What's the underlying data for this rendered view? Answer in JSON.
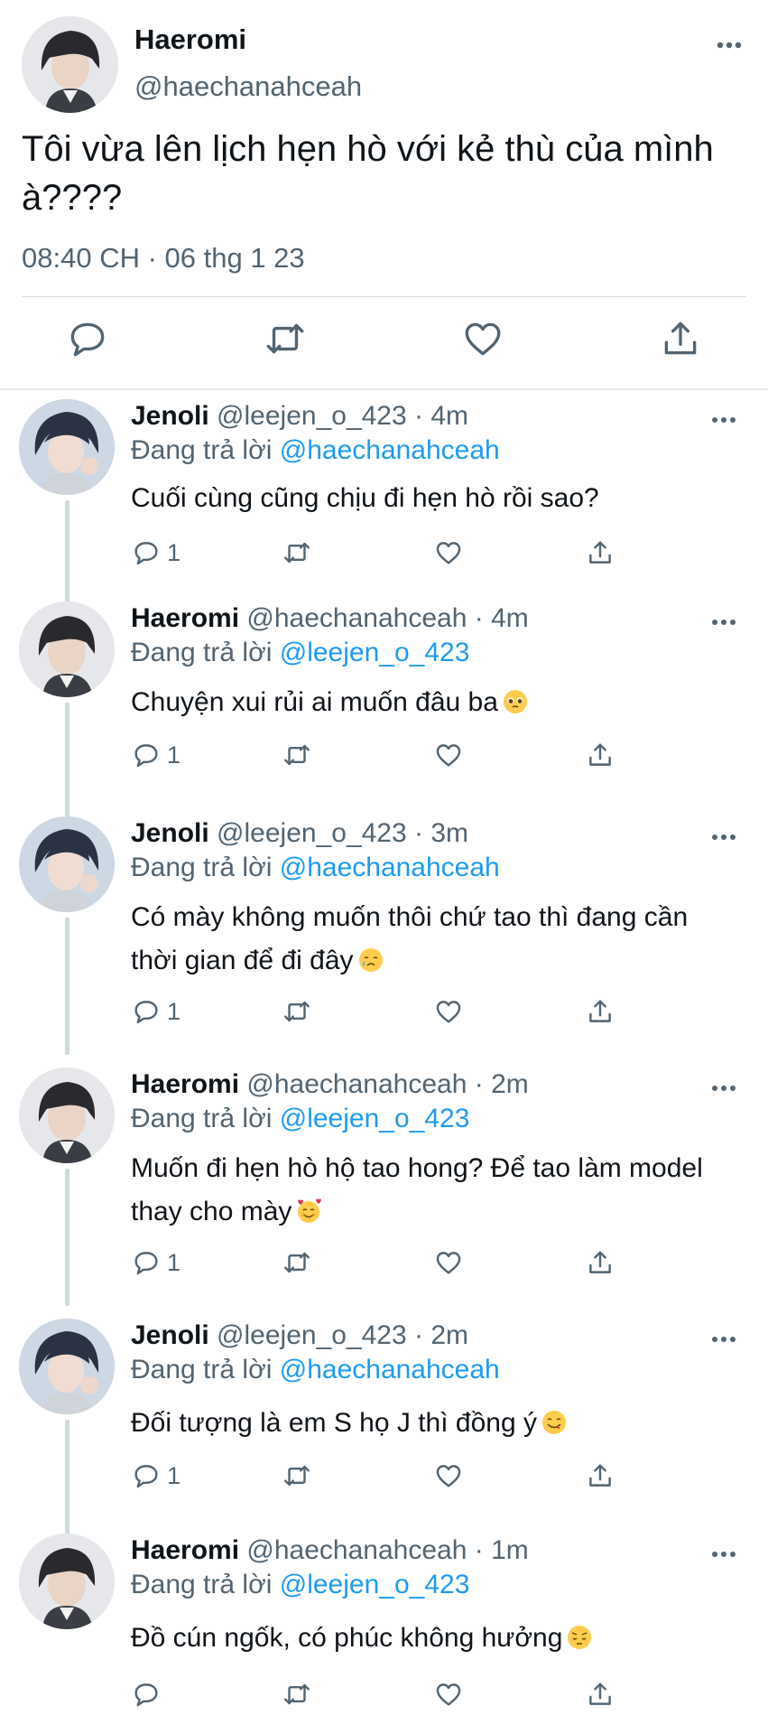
{
  "main_tweet": {
    "author_name": "Haeromi",
    "author_handle": "@haechanahceah",
    "text": "Tôi vừa lên lịch hẹn hò với kẻ thù của mình à????",
    "timestamp": "08:40 CH · 06 thg 1 23",
    "actions": [
      "reply-icon",
      "retweet-icon",
      "like-icon",
      "share-icon"
    ]
  },
  "replies": [
    {
      "name": "Jenoli",
      "handle": "@leejen_o_423",
      "dot": "·",
      "time": "4m",
      "replying_prefix": "Đang trả lời",
      "replying_to": "@haechanahceah",
      "text": "Cuối cùng cũng chịu đi hẹn hò rồi sao?",
      "emoji": "",
      "reply_count": "1"
    },
    {
      "name": "Haeromi",
      "handle": "@haechanahceah",
      "dot": "·",
      "time": "4m",
      "replying_prefix": "Đang trả lời",
      "replying_to": "@leejen_o_423",
      "text": "Chuyện xui rủi ai muốn đâu ba",
      "emoji": "pleading-face-emoji",
      "reply_count": "1"
    },
    {
      "name": "Jenoli",
      "handle": "@leejen_o_423",
      "dot": "·",
      "time": "3m",
      "replying_prefix": "Đang trả lời",
      "replying_to": "@haechanahceah",
      "text": "Có mày không muốn thôi chứ tao thì đang cần thời gian để đi đây",
      "emoji": "crying-face-emoji",
      "reply_count": "1"
    },
    {
      "name": "Haeromi",
      "handle": "@haechanahceah",
      "dot": "·",
      "time": "2m",
      "replying_prefix": "Đang trả lời",
      "replying_to": "@leejen_o_423",
      "text": "Muốn đi hẹn hò hộ tao hong? Để tao làm model thay cho mày",
      "emoji": "smiling-face-with-hearts-emoji",
      "reply_count": "1"
    },
    {
      "name": "Jenoli",
      "handle": "@leejen_o_423",
      "dot": "·",
      "time": "2m",
      "replying_prefix": "Đang trả lời",
      "replying_to": "@haechanahceah",
      "text": "Đối tượng là em S họ J thì đồng ý",
      "emoji": "face-savoring-food-emoji",
      "reply_count": "1"
    },
    {
      "name": "Haeromi",
      "handle": "@haechanahceah",
      "dot": "·",
      "time": "1m",
      "replying_prefix": "Đang trả lời",
      "replying_to": "@leejen_o_423",
      "text": "Đồ cún ngốk, có phúc không hưởng",
      "emoji": "pensive-face-emoji",
      "reply_count": ""
    }
  ],
  "colors": {
    "link": "#1d9bf0",
    "secondary_text": "#536471",
    "primary_text": "#0f1419",
    "divider": "#d9dde1"
  }
}
